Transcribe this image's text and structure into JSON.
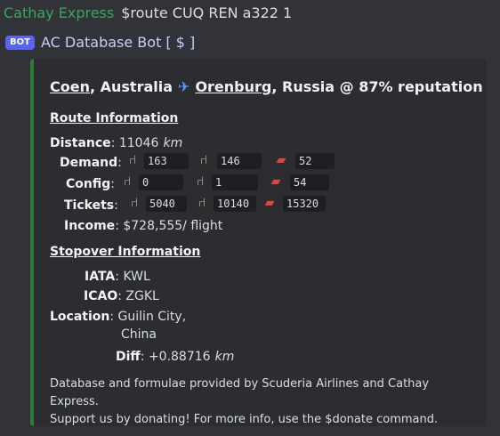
{
  "message": {
    "username": "Cathay Express",
    "command": "$route CUQ REN a322 1"
  },
  "bot": {
    "badge": "BOT",
    "name": "AC Database Bot [ $ ]"
  },
  "embed": {
    "title": {
      "origin_city": "Coen",
      "origin_country": ", Australia",
      "plane_icon": "✈",
      "dest_city": "Orenburg",
      "dest_suffix": ", Russia @ 87% reputation"
    },
    "route": {
      "heading": "Route Information",
      "distance_label": "Distance",
      "distance_value": "11046",
      "distance_unit": "km",
      "demand_label": "Demand",
      "demand": {
        "economy": "163",
        "business": "146",
        "first": "52"
      },
      "config_label": "Config",
      "config": {
        "economy": "0",
        "business": "1",
        "first": "54"
      },
      "tickets_label": "Tickets",
      "tickets": {
        "economy": "5040",
        "business": "10140",
        "first": "15320"
      },
      "income_label": "Income",
      "income_value": "$728,555/ flight"
    },
    "stopover": {
      "heading": "Stopover Information",
      "iata_label": "IATA",
      "iata_value": "KWL",
      "icao_label": "ICAO",
      "icao_value": "ZGKL",
      "location_label": "Location",
      "location_city": "Guilin City,",
      "location_country": "China",
      "diff_label": "Diff",
      "diff_value": "+0.88716",
      "diff_unit": "km"
    },
    "footer": {
      "line1": "Database and formulae provided by Scuderia Airlines and Cathay Express.",
      "line2": "Support us by donating! For more info, use the $donate command."
    },
    "colors": {
      "accent_bar": "#2e7d32",
      "username": "#3ba55c",
      "bot_badge": "#5865f2"
    }
  }
}
